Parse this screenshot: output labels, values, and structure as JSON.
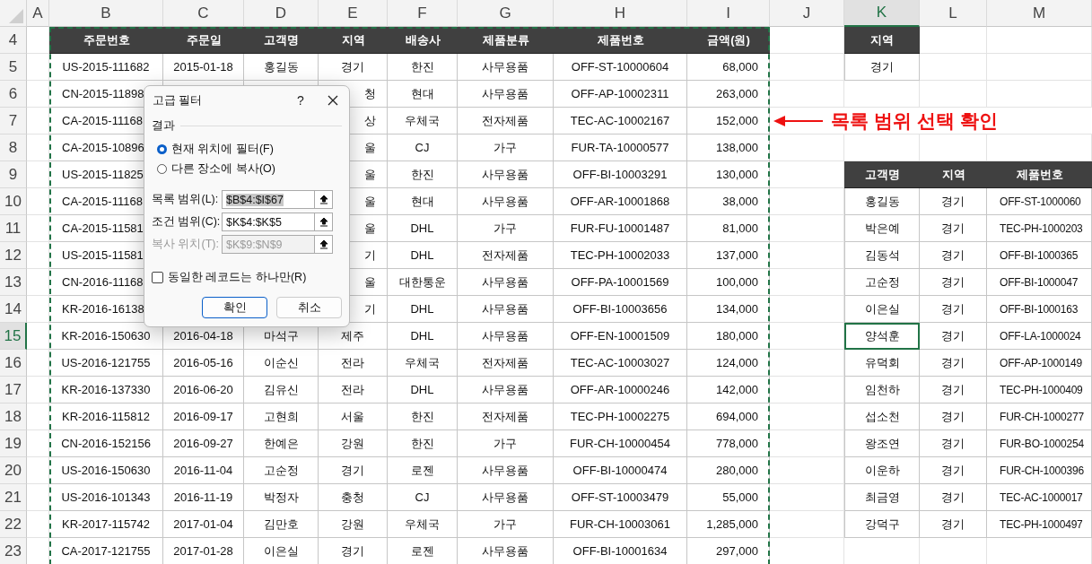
{
  "column_headers": [
    {
      "label": "A",
      "selected": false
    },
    {
      "label": "B",
      "selected": false
    },
    {
      "label": "C",
      "selected": false
    },
    {
      "label": "D",
      "selected": false
    },
    {
      "label": "E",
      "selected": false
    },
    {
      "label": "F",
      "selected": false
    },
    {
      "label": "G",
      "selected": false
    },
    {
      "label": "H",
      "selected": false
    },
    {
      "label": "I",
      "selected": false
    },
    {
      "label": "J",
      "selected": false
    },
    {
      "label": "K",
      "selected": true
    },
    {
      "label": "L",
      "selected": false
    },
    {
      "label": "M",
      "selected": false
    }
  ],
  "row_headers": [
    {
      "label": "4",
      "selected": false
    },
    {
      "label": "5",
      "selected": false
    },
    {
      "label": "6",
      "selected": false
    },
    {
      "label": "7",
      "selected": false
    },
    {
      "label": "8",
      "selected": false
    },
    {
      "label": "9",
      "selected": false
    },
    {
      "label": "10",
      "selected": false
    },
    {
      "label": "11",
      "selected": false
    },
    {
      "label": "12",
      "selected": false
    },
    {
      "label": "13",
      "selected": false
    },
    {
      "label": "14",
      "selected": false
    },
    {
      "label": "15",
      "selected": true
    },
    {
      "label": "16",
      "selected": false
    },
    {
      "label": "17",
      "selected": false
    },
    {
      "label": "18",
      "selected": false
    },
    {
      "label": "19",
      "selected": false
    },
    {
      "label": "20",
      "selected": false
    },
    {
      "label": "21",
      "selected": false
    },
    {
      "label": "22",
      "selected": false
    },
    {
      "label": "23",
      "selected": false
    }
  ],
  "orders_table": {
    "columns": [
      "주문번호",
      "주문일",
      "고객명",
      "지역",
      "배송사",
      "제품분류",
      "제품번호",
      "금액(원)"
    ],
    "rows": [
      {
        "order_id": "US-2015-111682",
        "order_date": "2015-01-18",
        "customer": "홍길동",
        "region": "경기",
        "carrier": "한진",
        "category": "사무용품",
        "product_no": "OFF-ST-10000604",
        "amount": "68,000"
      },
      {
        "order_id": "CN-2015-11898",
        "region": "청",
        "carrier": "현대",
        "category": "사무용품",
        "product_no": "OFF-AP-10002311",
        "amount": "263,000"
      },
      {
        "order_id": "CA-2015-11168",
        "region": "상",
        "carrier": "우체국",
        "category": "전자제품",
        "product_no": "TEC-AC-10002167",
        "amount": "152,000"
      },
      {
        "order_id": "CA-2015-10896",
        "region": "울",
        "carrier": "CJ",
        "category": "가구",
        "product_no": "FUR-TA-10000577",
        "amount": "138,000"
      },
      {
        "order_id": "US-2015-11825",
        "region": "울",
        "carrier": "한진",
        "category": "사무용품",
        "product_no": "OFF-BI-10003291",
        "amount": "130,000"
      },
      {
        "order_id": "CA-2015-11168",
        "region": "울",
        "carrier": "현대",
        "category": "사무용품",
        "product_no": "OFF-AR-10001868",
        "amount": "38,000"
      },
      {
        "order_id": "CA-2015-11581",
        "region": "울",
        "carrier": "DHL",
        "category": "가구",
        "product_no": "FUR-FU-10001487",
        "amount": "81,000"
      },
      {
        "order_id": "US-2015-11581",
        "region": "기",
        "carrier": "DHL",
        "category": "전자제품",
        "product_no": "TEC-PH-10002033",
        "amount": "137,000"
      },
      {
        "order_id": "CN-2016-11168",
        "region": "울",
        "carrier": "대한통운",
        "category": "사무용품",
        "product_no": "OFF-PA-10001569",
        "amount": "100,000"
      },
      {
        "order_id": "KR-2016-16138",
        "region": "기",
        "carrier": "DHL",
        "category": "사무용품",
        "product_no": "OFF-BI-10003656",
        "amount": "134,000"
      },
      {
        "order_id": "KR-2016-150630",
        "order_date": "2016-04-18",
        "customer": "마석구",
        "region": "제주",
        "carrier": "DHL",
        "category": "사무용품",
        "product_no": "OFF-EN-10001509",
        "amount": "180,000"
      },
      {
        "order_id": "US-2016-121755",
        "order_date": "2016-05-16",
        "customer": "이순신",
        "region": "전라",
        "carrier": "우체국",
        "category": "전자제품",
        "product_no": "TEC-AC-10003027",
        "amount": "124,000"
      },
      {
        "order_id": "KR-2016-137330",
        "order_date": "2016-06-20",
        "customer": "김유신",
        "region": "전라",
        "carrier": "DHL",
        "category": "사무용품",
        "product_no": "OFF-AR-10000246",
        "amount": "142,000"
      },
      {
        "order_id": "KR-2016-115812",
        "order_date": "2016-09-17",
        "customer": "고현희",
        "region": "서울",
        "carrier": "한진",
        "category": "전자제품",
        "product_no": "TEC-PH-10002275",
        "amount": "694,000"
      },
      {
        "order_id": "CN-2016-152156",
        "order_date": "2016-09-27",
        "customer": "한예은",
        "region": "강원",
        "carrier": "한진",
        "category": "가구",
        "product_no": "FUR-CH-10000454",
        "amount": "778,000"
      },
      {
        "order_id": "US-2016-150630",
        "order_date": "2016-11-04",
        "customer": "고순정",
        "region": "경기",
        "carrier": "로젠",
        "category": "사무용품",
        "product_no": "OFF-BI-10000474",
        "amount": "280,000"
      },
      {
        "order_id": "US-2016-101343",
        "order_date": "2016-11-19",
        "customer": "박정자",
        "region": "충청",
        "carrier": "CJ",
        "category": "사무용품",
        "product_no": "OFF-ST-10003479",
        "amount": "55,000"
      },
      {
        "order_id": "KR-2017-115742",
        "order_date": "2017-01-04",
        "customer": "김만호",
        "region": "강원",
        "carrier": "우체국",
        "category": "가구",
        "product_no": "FUR-CH-10003061",
        "amount": "1,285,000"
      },
      {
        "order_id": "CA-2017-121755",
        "order_date": "2017-01-28",
        "customer": "이은실",
        "region": "경기",
        "carrier": "로젠",
        "category": "사무용품",
        "product_no": "OFF-BI-10001634",
        "amount": "297,000"
      }
    ]
  },
  "criteria_table": {
    "column": "지역",
    "value": "경기"
  },
  "result_table": {
    "columns": [
      "고객명",
      "지역",
      "제품번호"
    ],
    "rows": [
      {
        "cells": [
          "홍길동",
          "경기",
          "OFF-ST-1000060"
        ],
        "selected": false
      },
      {
        "cells": [
          "박은예",
          "경기",
          "TEC-PH-1000203"
        ],
        "selected": false
      },
      {
        "cells": [
          "김동석",
          "경기",
          "OFF-BI-1000365"
        ],
        "selected": false
      },
      {
        "cells": [
          "고순정",
          "경기",
          "OFF-BI-1000047"
        ],
        "selected": false
      },
      {
        "cells": [
          "이은실",
          "경기",
          "OFF-BI-1000163"
        ],
        "selected": false
      },
      {
        "cells": [
          "양석훈",
          "경기",
          "OFF-LA-1000024"
        ],
        "selected": true
      },
      {
        "cells": [
          "유덕회",
          "경기",
          "OFF-AP-1000149"
        ],
        "selected": false
      },
      {
        "cells": [
          "임천하",
          "경기",
          "TEC-PH-1000409"
        ],
        "selected": false
      },
      {
        "cells": [
          "섭소천",
          "경기",
          "FUR-CH-1000277"
        ],
        "selected": false
      },
      {
        "cells": [
          "왕조연",
          "경기",
          "FUR-BO-1000254"
        ],
        "selected": false
      },
      {
        "cells": [
          "이운하",
          "경기",
          "FUR-CH-1000396"
        ],
        "selected": false
      },
      {
        "cells": [
          "최금영",
          "경기",
          "TEC-AC-1000017"
        ],
        "selected": false
      },
      {
        "cells": [
          "강덕구",
          "경기",
          "TEC-PH-1000497"
        ],
        "selected": false
      }
    ]
  },
  "annotation": {
    "text": "목록 범위 선택 확인"
  },
  "dialog": {
    "title": "고급 필터",
    "help": "?",
    "group_label": "결과",
    "radios": [
      {
        "label": "현재 위치에 필터(F)",
        "selected": true
      },
      {
        "label": "다른 장소에 복사(O)",
        "selected": false
      }
    ],
    "fields": [
      {
        "label": "목록 범위(L):",
        "value": "$B$4:$I$67",
        "disabled": false,
        "highlighted": true
      },
      {
        "label": "조건 범위(C):",
        "value": "$K$4:$K$5",
        "disabled": false,
        "highlighted": false
      },
      {
        "label": "복사 위치(T):",
        "value": "$K$9:$N$9",
        "disabled": true,
        "highlighted": false
      }
    ],
    "unique_checkbox": {
      "label": "동일한 레코드는 하나만(R)",
      "checked": false
    },
    "buttons": [
      {
        "label": "확인",
        "default": true
      },
      {
        "label": "취소",
        "default": false
      }
    ]
  }
}
